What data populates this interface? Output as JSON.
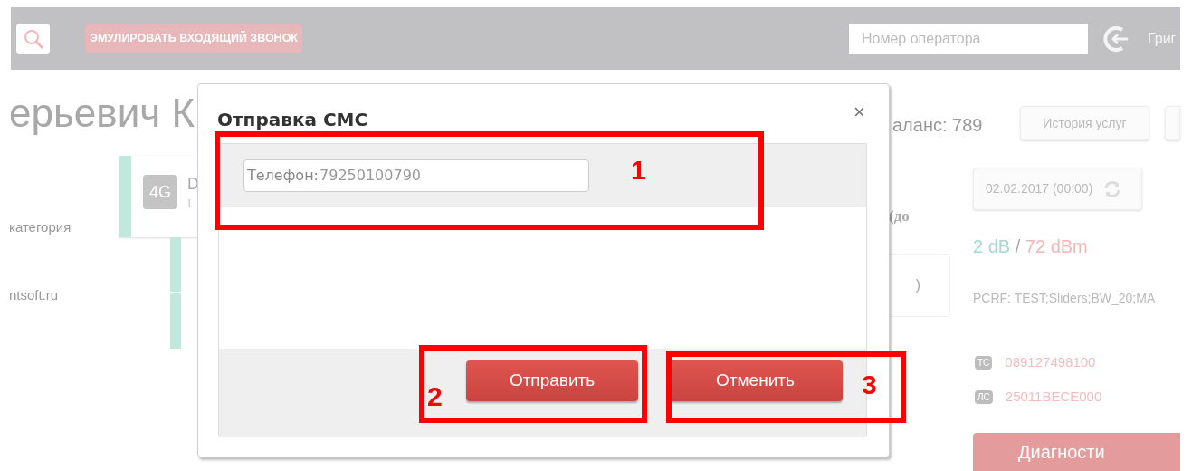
{
  "header": {
    "emulate_button": "ЭМУЛИРОВАТЬ ВХОДЯЩИЙ ЗВОНОК",
    "operator_field": {
      "placeholder": "Номер оператора"
    },
    "user_name": "Григ"
  },
  "profile": {
    "name": "ерьевич К",
    "category": "категория",
    "email": "ntsoft.ru",
    "card": {
      "badge": "4G",
      "title": "D",
      "subtitle": "I"
    },
    "balance": "аланс: 789",
    "history_button": "История услуг",
    "column_note": "(до",
    "box_text": ")",
    "date_button": "02.02.2017 (00:00)",
    "signal": {
      "snr": "2 dB",
      "separator": "/",
      "power": "72 dBm"
    },
    "pcrf": "PCRF: TEST;Sliders;BW_20;MA",
    "ids": [
      {
        "badge": "ТС",
        "value": "089127498100"
      },
      {
        "badge": "ЛС",
        "value": "25011BECE000"
      }
    ],
    "diagnostics_button": "Диагности"
  },
  "dialog": {
    "title": "Отправка СМС",
    "close": "×",
    "phone_label": "Телефон:",
    "phone_value": "79250100790",
    "buttons": [
      {
        "label": "Отправить"
      },
      {
        "label": "Отменить"
      }
    ]
  },
  "annotations": [
    {
      "label": "1"
    },
    {
      "label": "2"
    },
    {
      "label": "3"
    }
  ]
}
